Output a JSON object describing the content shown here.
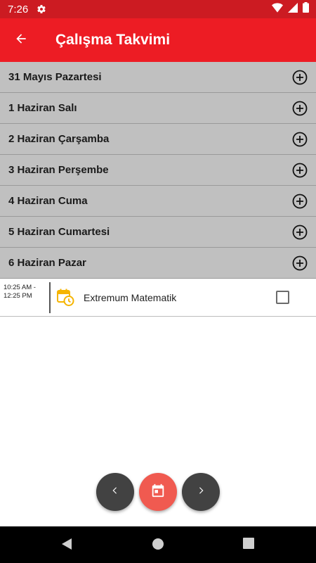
{
  "status_bar": {
    "time": "7:26",
    "icons": [
      "gear-icon",
      "wifi-icon",
      "signal-icon",
      "battery-icon"
    ]
  },
  "app_bar": {
    "title": "Çalışma Takvimi",
    "back_icon": "arrow-back-icon"
  },
  "days": [
    {
      "label": "31 Mayıs Pazartesi"
    },
    {
      "label": "1 Haziran Salı"
    },
    {
      "label": "2 Haziran Çarşamba"
    },
    {
      "label": "3 Haziran Perşembe"
    },
    {
      "label": "4 Haziran Cuma"
    },
    {
      "label": "5 Haziran Cumartesi"
    },
    {
      "label": "6 Haziran Pazar"
    }
  ],
  "event": {
    "time_start": "10:25 AM -",
    "time_end": "12:25 PM",
    "title": "Extremum Matematik",
    "icon": "calendar-clock-icon",
    "checked": false
  },
  "fabs": {
    "prev_icon": "chevron-left-icon",
    "calendar_icon": "calendar-icon",
    "next_icon": "chevron-right-icon"
  },
  "colors": {
    "status_bar": "#cc1b22",
    "app_bar": "#ed1c24",
    "day_row": "#c0c0c0",
    "fab_dark": "#424242",
    "fab_accent": "#f05a50",
    "event_icon": "#f5b400"
  },
  "nav_bar": {
    "icons": [
      "back-triangle-icon",
      "home-circle-icon",
      "recents-square-icon"
    ]
  }
}
